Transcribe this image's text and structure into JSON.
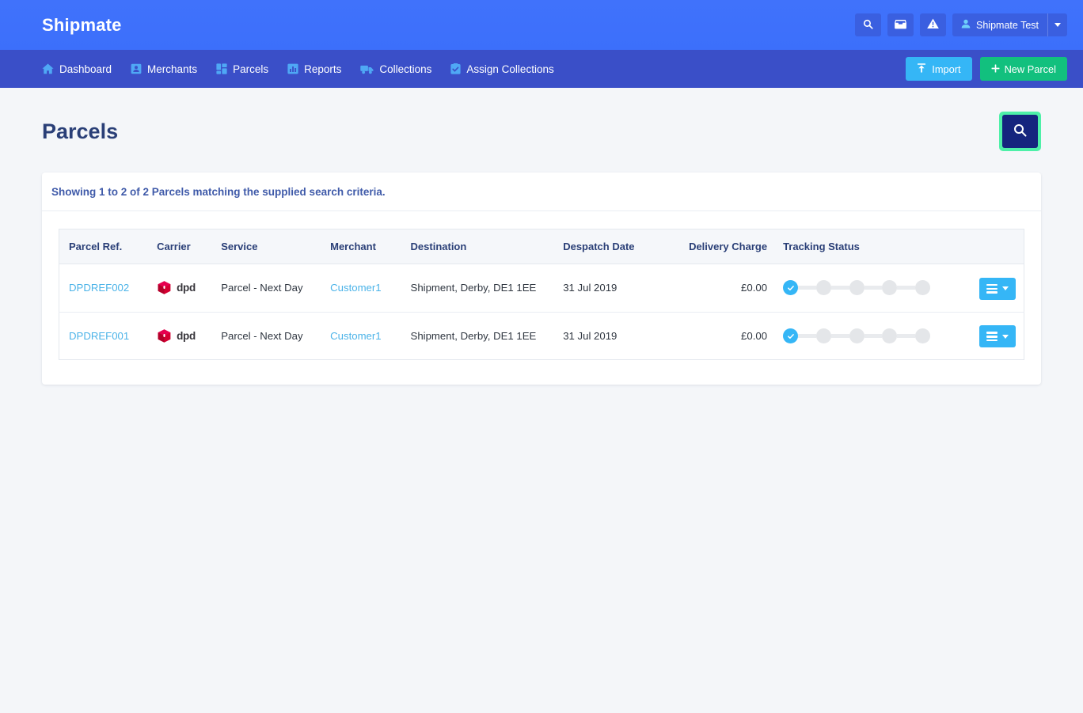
{
  "topbar": {
    "brand": "Shipmate",
    "search_icon": "search-icon",
    "inbox_icon": "inbox-icon",
    "alert_icon": "warning-triangle-icon",
    "user_name": "Shipmate Test",
    "user_icon": "user-icon",
    "caret_icon": "chevron-down-icon"
  },
  "nav": {
    "items": [
      {
        "label": "Dashboard",
        "icon": "home-icon"
      },
      {
        "label": "Merchants",
        "icon": "id-card-icon"
      },
      {
        "label": "Parcels",
        "icon": "grid-tiles-icon"
      },
      {
        "label": "Reports",
        "icon": "bar-chart-icon"
      },
      {
        "label": "Collections",
        "icon": "truck-icon"
      },
      {
        "label": "Assign Collections",
        "icon": "clipboard-check-icon"
      }
    ],
    "import_label": "Import",
    "import_icon": "upload-icon",
    "new_parcel_label": "New Parcel",
    "new_parcel_icon": "plus-icon"
  },
  "page": {
    "title": "Parcels",
    "search_button_icon": "search-icon",
    "note": "Showing 1 to 2 of 2 Parcels matching the supplied search criteria."
  },
  "table": {
    "headers": [
      "Parcel Ref.",
      "Carrier",
      "Service",
      "Merchant",
      "Destination",
      "Despatch Date",
      "Delivery Charge",
      "Tracking Status"
    ],
    "rows": [
      {
        "ref": "DPDREF002",
        "carrier": "dpd",
        "carrier_icon": "dpd-cube-logo",
        "service": "Parcel - Next Day",
        "merchant": "Customer1",
        "destination": "Shipment, Derby, DE1 1EE",
        "despatch_date": "31 Jul 2019",
        "delivery_charge": "£0.00",
        "tracking_steps_total": 5,
        "tracking_steps_done": 1,
        "actions_icon": "hamburger-menu-icon"
      },
      {
        "ref": "DPDREF001",
        "carrier": "dpd",
        "carrier_icon": "dpd-cube-logo",
        "service": "Parcel - Next Day",
        "merchant": "Customer1",
        "destination": "Shipment, Derby, DE1 1EE",
        "despatch_date": "31 Jul 2019",
        "delivery_charge": "£0.00",
        "tracking_steps_total": 5,
        "tracking_steps_done": 1,
        "actions_icon": "hamburger-menu-icon"
      }
    ]
  },
  "colors": {
    "topbar": "#3c6ffb",
    "navbar": "#3a4fc8",
    "accent_blue": "#35b6f6",
    "accent_green": "#12c07e",
    "focus_green": "#4ef0a8",
    "search_navy": "#15247e",
    "heading_navy": "#2a3f77",
    "dpd_red": "#d50032"
  }
}
